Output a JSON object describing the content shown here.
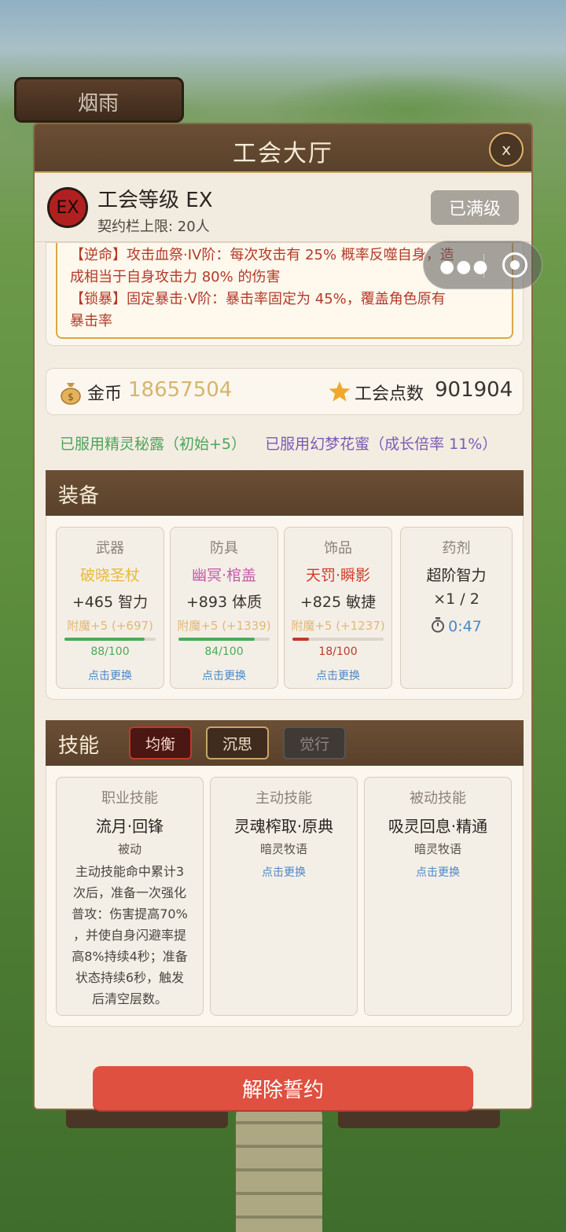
{
  "background": {
    "banner_text": "烟雨"
  },
  "modal": {
    "title": "工会大厅",
    "close_label": "x"
  },
  "guild_level": {
    "badge": "EX",
    "title": "工会等级 EX",
    "contract_limit": "契约栏上限: 20人",
    "maxed_label": "已满级"
  },
  "effects": [
    "【逆命】攻击血祭·IV阶：每次攻击有 25% 概率反噬自身，造",
    "成相当于自身攻击力 80% 的伤害",
    "【锁暴】固定暴击·V阶：暴击率固定为 45%，覆盖角色原有",
    "暴击率"
  ],
  "currency": {
    "gold_label": "金币",
    "gold_value": "18657504",
    "points_label": "工会点数",
    "points_value": "901904"
  },
  "buffs": {
    "elixir": "已服用精灵秘露（初始+5）",
    "nectar": "已服用幻梦花蜜（成长倍率 11%）"
  },
  "equipment": {
    "section_title": "装备",
    "items": [
      {
        "slot": "武器",
        "name": "破晓圣杖",
        "name_color": "#e8b93a",
        "stat": "+465 智力",
        "enchant": "附魔+5 (+697)",
        "durability_text": "88/100",
        "durability": 0.88,
        "bar_color": "#4caa58",
        "dur_color": "#4caa58",
        "change": "点击更换"
      },
      {
        "slot": "防具",
        "name": "幽冥·棺盖",
        "name_color": "#c45aa8",
        "stat": "+893 体质",
        "enchant": "附魔+5 (+1339)",
        "durability_text": "84/100",
        "durability": 0.84,
        "bar_color": "#4caa58",
        "dur_color": "#4caa58",
        "change": "点击更换"
      },
      {
        "slot": "饰品",
        "name": "天罚·瞬影",
        "name_color": "#d03a2a",
        "stat": "+825 敏捷",
        "enchant": "附魔+5 (+1237)",
        "durability_text": "18/100",
        "durability": 0.18,
        "bar_color": "#c0392b",
        "dur_color": "#b43c2c",
        "change": "点击更换"
      }
    ],
    "potion": {
      "slot": "药剂",
      "name": "超阶智力",
      "count": "×1 / 2",
      "timer": "0:47"
    }
  },
  "skills": {
    "section_title": "技能",
    "tabs": [
      {
        "label": "均衡",
        "state": "active"
      },
      {
        "label": "沉思",
        "state": "normal"
      },
      {
        "label": "觉行",
        "state": "disabled"
      }
    ],
    "cards": [
      {
        "type": "职业技能",
        "name": "流月·回锋",
        "sub": "被动",
        "desc": [
          "主动技能命中累计3",
          "次后，准备一次强化",
          "普攻：伤害提高70%",
          "，并使自身闪避率提",
          "高8%持续4秒；准备",
          "状态持续6秒，触发",
          "后清空层数。"
        ]
      },
      {
        "type": "主动技能",
        "name": "灵魂榨取·原典",
        "sub": "暗灵牧语",
        "change": "点击更换"
      },
      {
        "type": "被动技能",
        "name": "吸灵回息·精通",
        "sub": "暗灵牧语",
        "change": "点击更换"
      }
    ]
  },
  "dismiss_label": "解除誓约"
}
